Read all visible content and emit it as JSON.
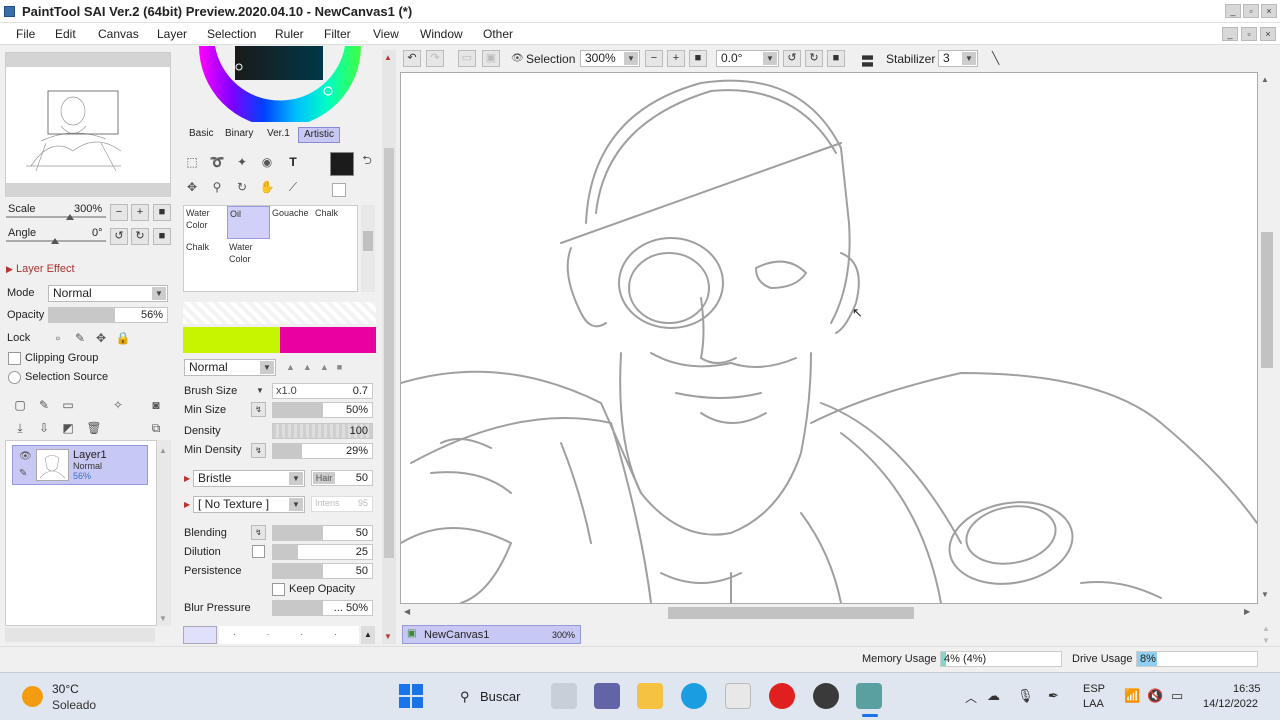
{
  "window": {
    "title": "PaintTool SAI Ver.2 (64bit) Preview.2020.04.10 - NewCanvas1 (*)",
    "controls": [
      "_",
      "▫",
      "×"
    ]
  },
  "menu": [
    "File",
    "Edit",
    "Canvas",
    "Layer",
    "Selection",
    "Ruler",
    "Filter",
    "View",
    "Window",
    "Other"
  ],
  "navigator": {
    "scale_label": "Scale",
    "scale_value": "300%",
    "scale_fill": 0.6,
    "angle_label": "Angle",
    "angle_value": "0°",
    "angle_fill": 0.5
  },
  "layer_panel": {
    "effect_label": "Layer Effect",
    "mode_label": "Mode",
    "mode_value": "Normal",
    "opacity_label": "Opacity",
    "opacity_value": "56%",
    "opacity_fill": 0.56,
    "lock_label": "Lock",
    "clipping_label": "Clipping Group",
    "selection_source_label": "Selection Source",
    "layers": [
      {
        "name": "Layer1",
        "mode": "Normal",
        "opacity": "56%"
      }
    ]
  },
  "color": {
    "current": "#1b1b1b"
  },
  "tool_tabs": [
    "Basic",
    "Binary",
    "Ver.1",
    "Artistic"
  ],
  "active_tool_tab": "Artistic",
  "brushes": [
    {
      "name": "Water Color"
    },
    {
      "name": "Oil"
    },
    {
      "name": "Gouache"
    },
    {
      "name": "Chalk"
    },
    {
      "name": "Chalk"
    },
    {
      "name": "Water Color"
    }
  ],
  "brush_settings": {
    "blend_mode": "Normal",
    "brush_size_label": "Brush Size",
    "brush_size_mult": "x1.0",
    "brush_size_value": "0.7",
    "min_size_label": "Min Size",
    "min_size_value": "50%",
    "min_size_fill": 0.5,
    "density_label": "Density",
    "density_value": "100",
    "density_fill": 1.0,
    "min_density_label": "Min Density",
    "min_density_value": "29%",
    "min_density_fill": 0.29,
    "shape_value": "Bristle",
    "shape_param_label": "Hair",
    "shape_param_value": "50",
    "texture_value": "[ No Texture ]",
    "texture_param_label": "Intens",
    "texture_param_value": "95",
    "blending_label": "Blending",
    "blending_value": "50",
    "blending_fill": 0.5,
    "dilution_label": "Dilution",
    "dilution_value": "25",
    "dilution_fill": 0.25,
    "persistence_label": "Persistence",
    "persistence_value": "50",
    "persistence_fill": 0.5,
    "keep_opacity_label": "Keep Opacity",
    "blur_pressure_label": "Blur Pressure",
    "blur_pressure_value": "... 50%",
    "blur_pressure_fill": 0.5
  },
  "canvas_toolbar": {
    "selection_label": "Selection",
    "zoom_value": "300%",
    "rotation_value": "0.0°",
    "stabilizer_label": "Stabilizer",
    "stabilizer_value": "3"
  },
  "canvas_tab": {
    "name": "NewCanvas1",
    "zoom": "300%"
  },
  "status": {
    "memory_label": "Memory Usage",
    "memory_value": "4% (4%)",
    "drive_label": "Drive Usage",
    "drive_value": "8%"
  },
  "taskbar": {
    "weather_temp": "30°C",
    "weather_desc": "Soleado",
    "search_label": "Buscar",
    "lang_1": "ESP",
    "lang_2": "LAA",
    "time": "16:35",
    "date": "14/12/2022"
  }
}
